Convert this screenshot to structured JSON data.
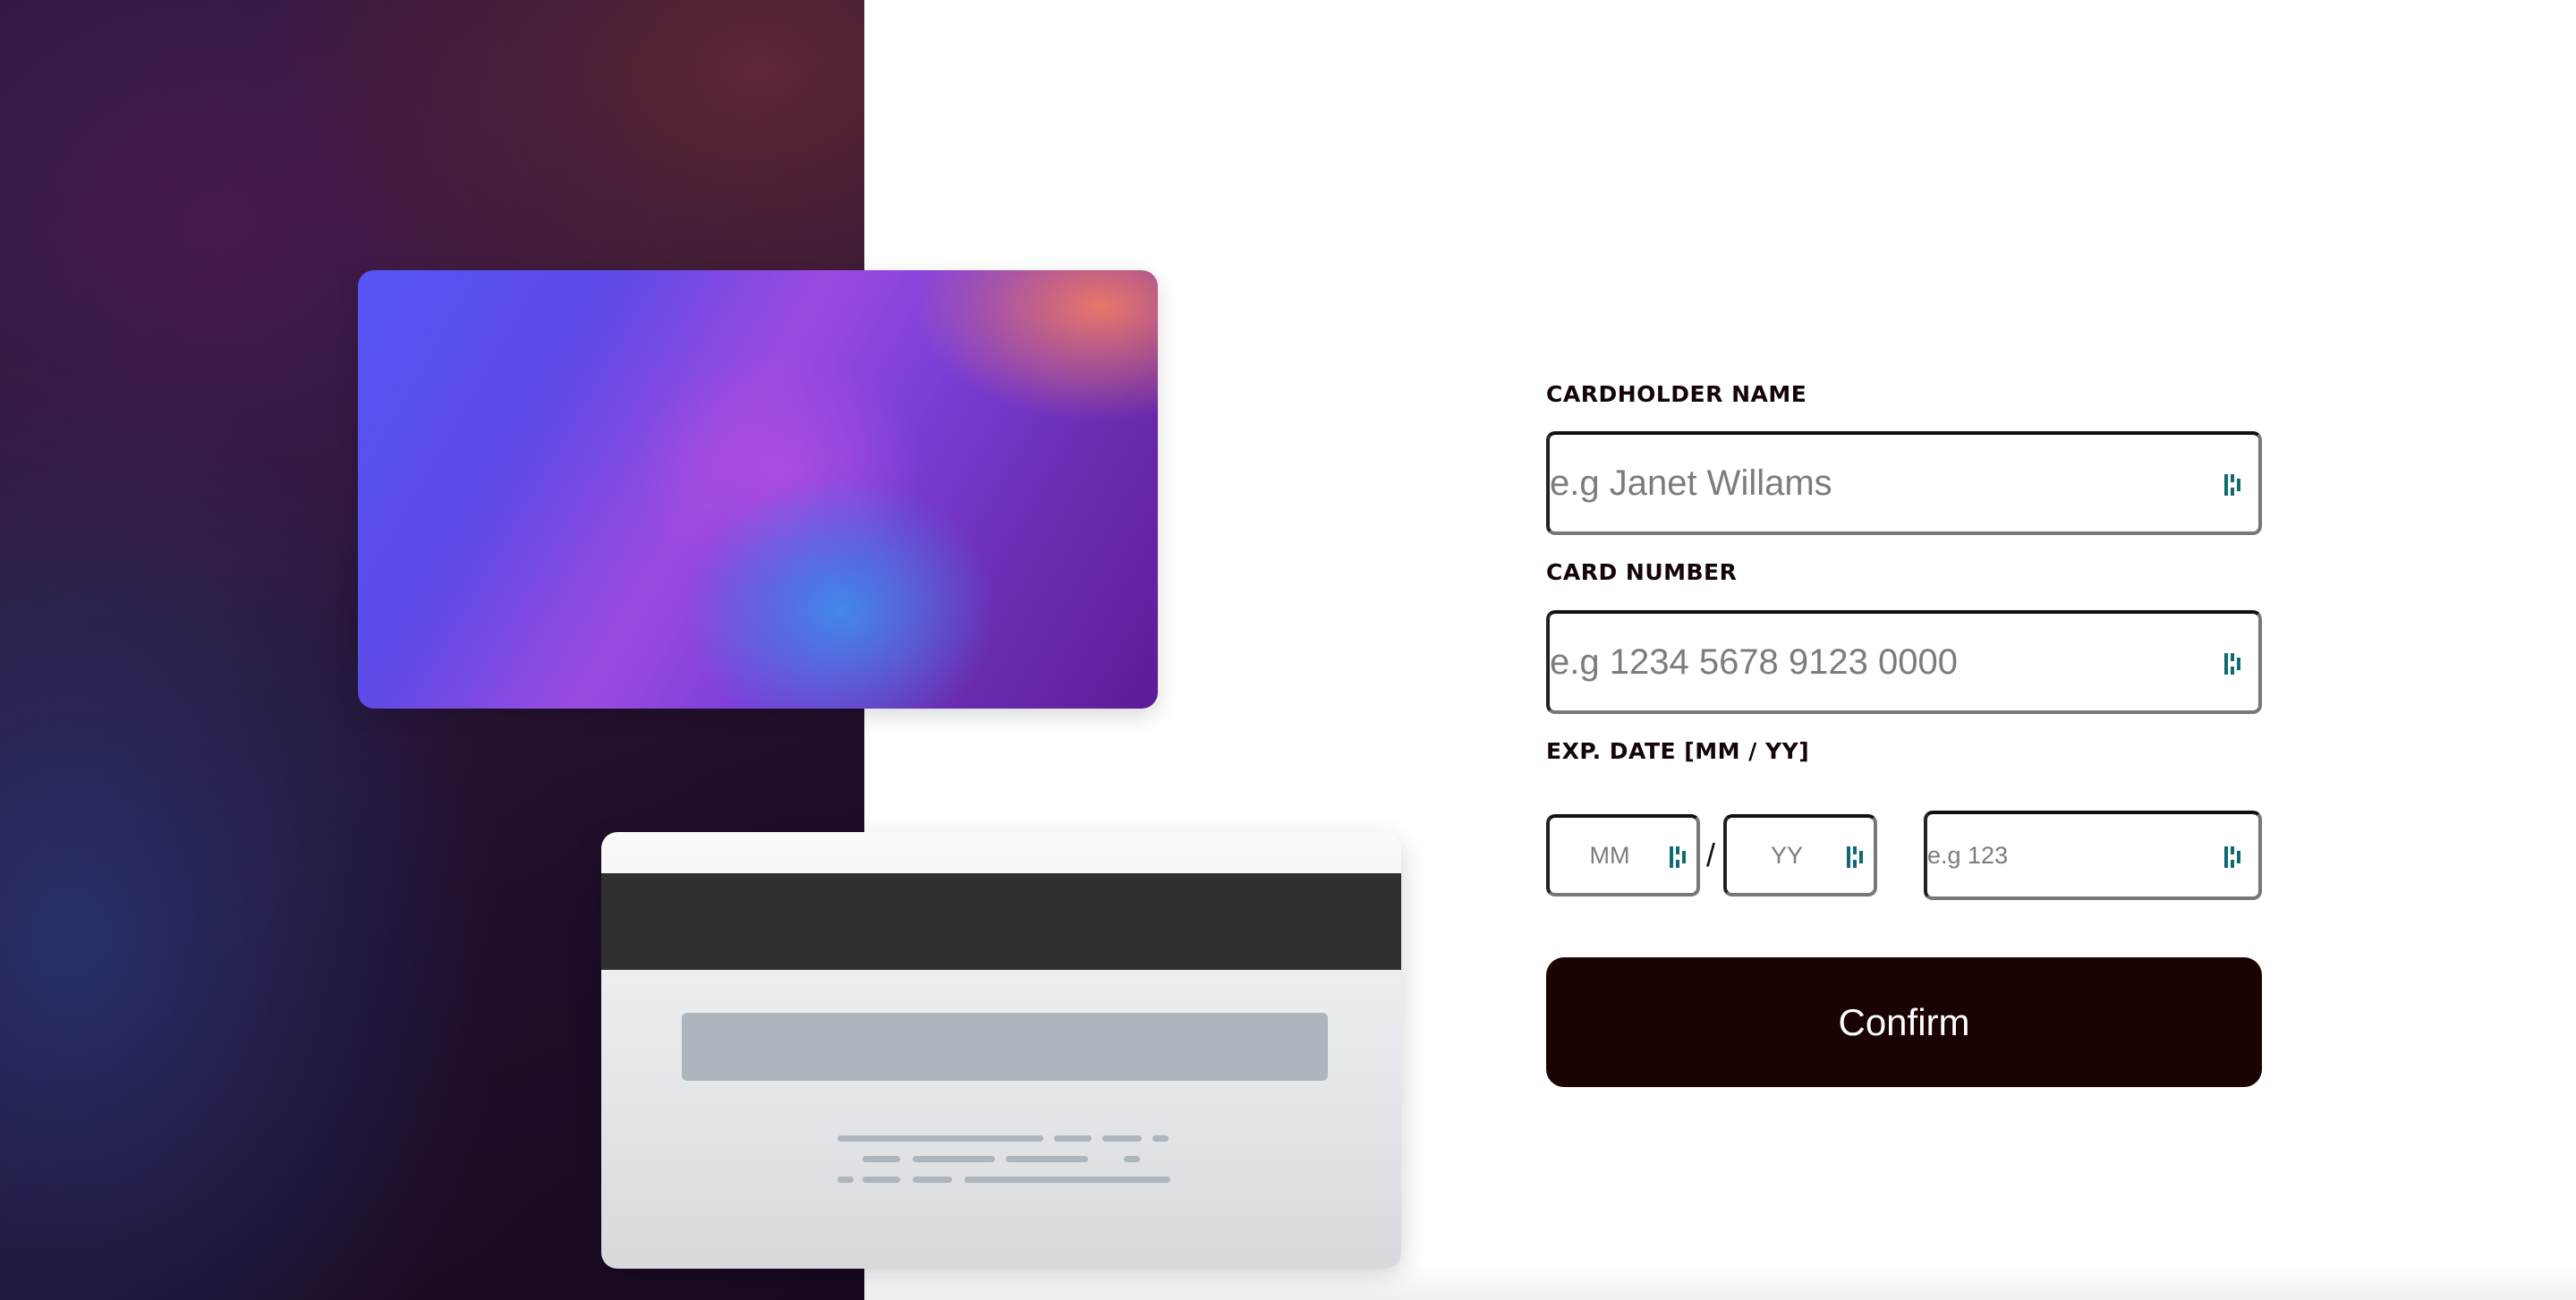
{
  "form": {
    "cardholder_name": {
      "label": "CARDHOLDER NAME",
      "placeholder": "e.g Janet Willams",
      "value": ""
    },
    "card_number": {
      "label": "CARD NUMBER",
      "placeholder": "e.g 1234 5678 9123 0000",
      "value": ""
    },
    "exp_date": {
      "label": "EXP. DATE [MM / YY]",
      "month_placeholder": "MM",
      "year_placeholder": "YY",
      "separator": "/"
    },
    "cvc": {
      "placeholder": "e.g 123",
      "value": ""
    },
    "confirm_label": "Confirm"
  },
  "icons": {
    "field_autofill_icon": "password-manager-icon"
  },
  "colors": {
    "confirm_button_bg": "#1a0303",
    "autofill_icon": "#0e6b73",
    "label_text": "#14050a"
  }
}
